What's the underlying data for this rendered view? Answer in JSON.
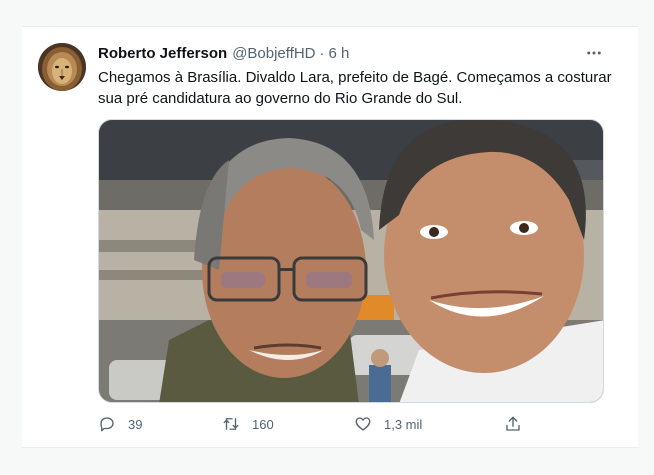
{
  "tweet": {
    "display_name": "Roberto Jefferson",
    "handle": "@BobjeffHD",
    "separator": "·",
    "time": "6 h",
    "text": "Chegamos à Brasília. Divaldo Lara, prefeito de Bagé. Começamos a costurar sua pré candidatura ao governo do Rio Grande do Sul."
  },
  "actions": {
    "replies": "39",
    "retweets": "160",
    "likes": "1,3 mil"
  },
  "icons": {
    "more": "more-horizontal-icon",
    "reply": "reply-icon",
    "retweet": "retweet-icon",
    "like": "heart-icon",
    "share": "share-icon"
  },
  "colors": {
    "background": "#f7f9f9",
    "card": "#ffffff",
    "text": "#0f1419",
    "secondary": "#536471",
    "border": "#cfd9de"
  }
}
